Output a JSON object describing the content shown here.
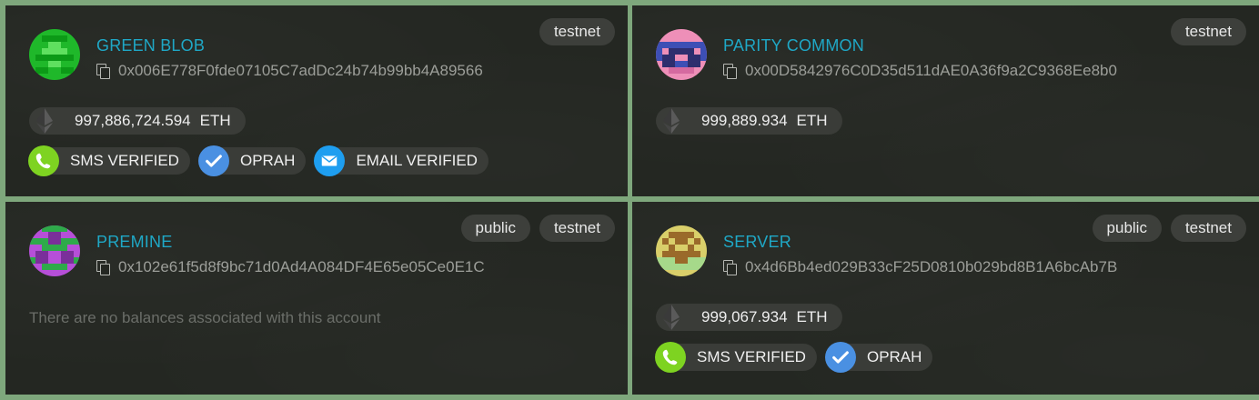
{
  "accounts": [
    {
      "name": "GREEN BLOB",
      "address": "0x006E778F0fde07105C7adDc24b74b99bb4A89566",
      "tags": [
        "testnet"
      ],
      "balance": {
        "amount": "997,886,724.594",
        "unit": "ETH"
      },
      "no_balance_text": "",
      "badges": [
        {
          "label": "SMS VERIFIED",
          "icon": "phone-icon",
          "color": "#7ed321"
        },
        {
          "label": "OPRAH",
          "icon": "checkmark-icon",
          "color": "#4a90e2"
        },
        {
          "label": "EMAIL VERIFIED",
          "icon": "envelope-icon",
          "color": "#1e9ef0"
        }
      ]
    },
    {
      "name": "PARITY COMMON",
      "address": "0x00D5842976C0D35d511dAE0A36f9a2C9368Ee8b0",
      "tags": [
        "testnet"
      ],
      "balance": {
        "amount": "999,889.934",
        "unit": "ETH"
      },
      "no_balance_text": "",
      "badges": []
    },
    {
      "name": "PREMINE",
      "address": "0x102e61f5d8f9bc71d0Ad4A084DF4E65e05Ce0E1C",
      "tags": [
        "public",
        "testnet"
      ],
      "balance": null,
      "no_balance_text": "There are no balances associated with this account",
      "badges": []
    },
    {
      "name": "SERVER",
      "address": "0x4d6Bb4ed029B33cF25D0810b029bd8B1A6bcAb7B",
      "tags": [
        "public",
        "testnet"
      ],
      "balance": {
        "amount": "999,067.934",
        "unit": "ETH"
      },
      "no_balance_text": "",
      "badges": [
        {
          "label": "SMS VERIFIED",
          "icon": "phone-icon",
          "color": "#7ed321"
        },
        {
          "label": "OPRAH",
          "icon": "checkmark-icon",
          "color": "#4a90e2"
        }
      ]
    }
  ],
  "colors": {
    "name": "#1fa8c6",
    "card_bg": "#242722",
    "page_bg": "#7ea77c",
    "pill_bg": "#3a3c38"
  }
}
